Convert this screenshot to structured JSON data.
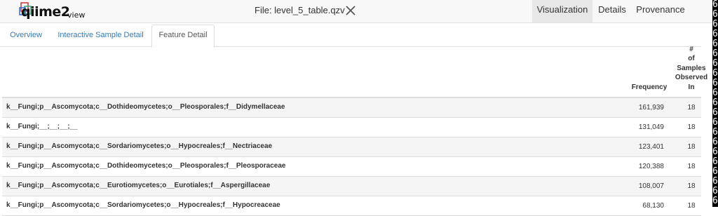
{
  "app": {
    "brand": "qiime2",
    "brand_sub": "view"
  },
  "header": {
    "file_label": "File: level_5_table.qzv",
    "close_icon": "close-icon",
    "tabs": [
      {
        "label": "Visualization",
        "active": true
      },
      {
        "label": "Details",
        "active": false
      },
      {
        "label": "Provenance",
        "active": false
      }
    ]
  },
  "subtabs": [
    {
      "label": "Overview",
      "active": false
    },
    {
      "label": "Interactive Sample Detail",
      "active": false
    },
    {
      "label": "Feature Detail",
      "active": true
    }
  ],
  "table": {
    "headers": {
      "feature": "",
      "frequency": "Frequency",
      "samples": "# of Samples Observed In"
    },
    "rows": [
      {
        "feature": "k__Fungi;p__Ascomycota;c__Dothideomycetes;o__Pleosporales;f__Didymellaceae",
        "frequency": "161,939",
        "samples": "18"
      },
      {
        "feature": "k__Fungi;__;__;__;__",
        "frequency": "131,049",
        "samples": "18"
      },
      {
        "feature": "k__Fungi;p__Ascomycota;c__Sordariomycetes;o__Hypocreales;f__Nectriaceae",
        "frequency": "123,401",
        "samples": "18"
      },
      {
        "feature": "k__Fungi;p__Ascomycota;c__Dothideomycetes;o__Pleosporales;f__Pleosporaceae",
        "frequency": "120,388",
        "samples": "18"
      },
      {
        "feature": "k__Fungi;p__Ascomycota;c__Eurotiomycetes;o__Eurotiales;f__Aspergillaceae",
        "frequency": "108,007",
        "samples": "18"
      },
      {
        "feature": "k__Fungi;p__Ascomycota;c__Sordariomycetes;o__Hypocreales;f__Hypocreaceae",
        "frequency": "68,130",
        "samples": "18"
      }
    ]
  },
  "edge_strip": {
    "char": "6",
    "count": 21
  },
  "colors": {
    "link": "#337ab7",
    "active_nav": "#e7e7e7",
    "striped_row": "#f5f5f5"
  }
}
